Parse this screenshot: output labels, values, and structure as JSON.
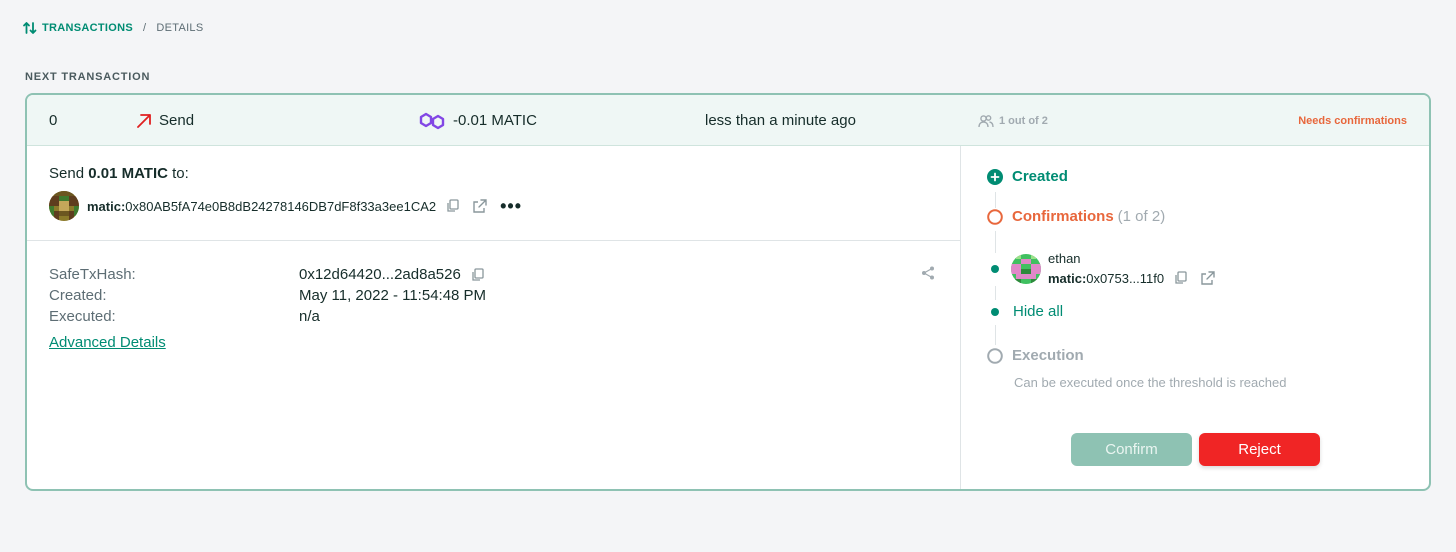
{
  "breadcrumb": {
    "icon": "arrows-up-down-icon",
    "section": "TRANSACTIONS",
    "separator": "/",
    "current": "DETAILS"
  },
  "section_title": "NEXT TRANSACTION",
  "transaction": {
    "nonce": "0",
    "type_label": "Send",
    "type_icon": "arrow-up-right-icon",
    "amount": "-0.01 MATIC",
    "token_icon": "polygon-icon",
    "time": "less than a minute ago",
    "owners": "1 out of 2",
    "status": "Needs confirmations",
    "status_color": "#e8673c"
  },
  "send": {
    "prefix": "Send",
    "amount": "0.01 MATIC",
    "suffix": "to:",
    "chain_prefix": "matic:",
    "address": "0x80AB5fA74e0B8dB24278146DB7dF8f33a3ee1CA2",
    "more": "•••"
  },
  "details": {
    "safetxhash_label": "SafeTxHash:",
    "safetxhash_value": "0x12d64420...2ad8a526",
    "created_label": "Created:",
    "created_value": "May 11, 2022 - 11:54:48 PM",
    "executed_label": "Executed:",
    "executed_value": "n/a",
    "advanced_link": "Advanced Details"
  },
  "timeline": {
    "created": "Created",
    "confirmations_label": "Confirmations",
    "confirmations_count": "(1 of 2)",
    "owner_name": "ethan",
    "owner_prefix": "matic:",
    "owner_address": "0x0753...11f0",
    "hide_all": "Hide all",
    "execution": "Execution",
    "execution_note": "Can be executed once the threshold is reached"
  },
  "actions": {
    "confirm": "Confirm",
    "reject": "Reject"
  },
  "colors": {
    "accent": "#008c73",
    "warning": "#e8673c",
    "danger": "#f02525",
    "border": "#8ec2b3"
  }
}
